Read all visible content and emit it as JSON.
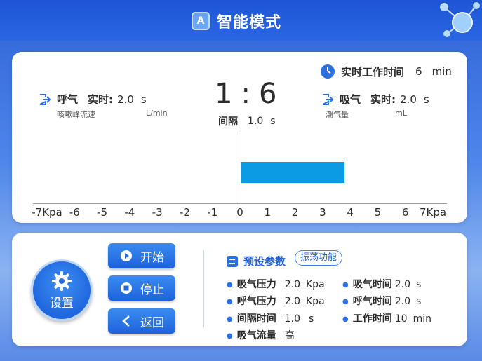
{
  "header": {
    "title": "智能模式",
    "icon_letter": "A"
  },
  "top_panel": {
    "work_time": {
      "label": "实时工作时间",
      "value": "6",
      "unit": "min"
    },
    "exhale": {
      "label": "呼气",
      "realtime_label": "实时:",
      "value": "2.0",
      "unit": "s",
      "sub_label": "咳嗽峰流速",
      "sub_unit": "L/min"
    },
    "ratio": {
      "left": "1",
      "sep": ":",
      "right": "6"
    },
    "interval": {
      "label": "间隔",
      "value": "1.0",
      "unit": "s"
    },
    "inhale": {
      "label": "吸气",
      "realtime_label": "实时:",
      "value": "2.0",
      "unit": "s",
      "sub_label": "潮气量",
      "sub_unit": "mL"
    },
    "pressure_bar": {
      "value": 3.8,
      "min": -7,
      "max": 7,
      "color": "#0a9be4"
    },
    "axis_ticks": [
      "-7Kpa",
      "-6",
      "-5",
      "-4",
      "-3",
      "-2",
      "-1",
      "0",
      "1",
      "2",
      "3",
      "4",
      "5",
      "6",
      "7Kpa"
    ]
  },
  "controls": {
    "setting_label": "设置",
    "start_label": "开始",
    "stop_label": "停止",
    "back_label": "返回"
  },
  "presets": {
    "title": "预设参数",
    "func_tag": "振荡功能",
    "left": [
      {
        "name": "吸气压力",
        "value": "2.0",
        "unit": "Kpa"
      },
      {
        "name": "呼气压力",
        "value": "2.0",
        "unit": "Kpa"
      },
      {
        "name": "间隔时间",
        "value": "1.0",
        "unit": "s"
      },
      {
        "name": "吸气流量",
        "value": "高",
        "unit": ""
      }
    ],
    "right": [
      {
        "name": "吸气时间",
        "value": "2.0",
        "unit": "s"
      },
      {
        "name": "呼气时间",
        "value": "2.0",
        "unit": "s"
      },
      {
        "name": "工作时间",
        "value": "10",
        "unit": "min"
      }
    ]
  },
  "colors": {
    "accent": "#1f5fd6",
    "bar": "#0a9be4",
    "header": "#2a66e3"
  }
}
